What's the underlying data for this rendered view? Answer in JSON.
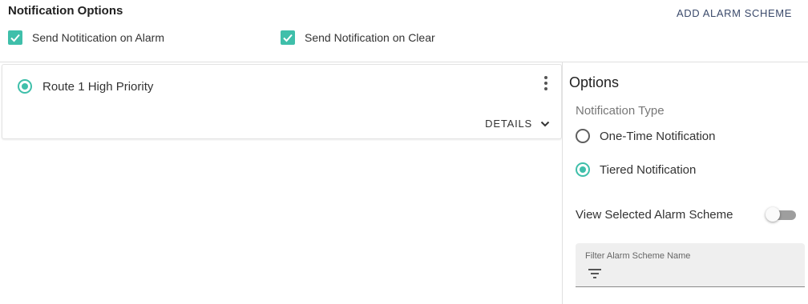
{
  "header": {
    "title": "Notification Options",
    "add_button_label": "ADD ALARM SCHEME"
  },
  "checkboxes": [
    {
      "label": "Send Notitication on Alarm",
      "checked": true
    },
    {
      "label": "Send Notification on Clear",
      "checked": true
    }
  ],
  "route": {
    "label": "Route 1 High Priority",
    "selected": true,
    "details_label": "DETAILS"
  },
  "options": {
    "title": "Options",
    "notification_type_label": "Notification Type",
    "choices": [
      {
        "label": "One-Time Notification",
        "selected": false
      },
      {
        "label": "Tiered Notification",
        "selected": true
      }
    ],
    "view_selected_label": "View Selected Alarm Scheme",
    "view_selected_on": false,
    "filter_placeholder": "Filter Alarm Scheme Name"
  },
  "colors": {
    "accent": "#3fbfaa",
    "link": "#3b4a6b"
  },
  "icons": {
    "check": "check-icon",
    "more": "more-vertical-icon",
    "chevron": "chevron-down-icon",
    "filter": "filter-icon"
  }
}
